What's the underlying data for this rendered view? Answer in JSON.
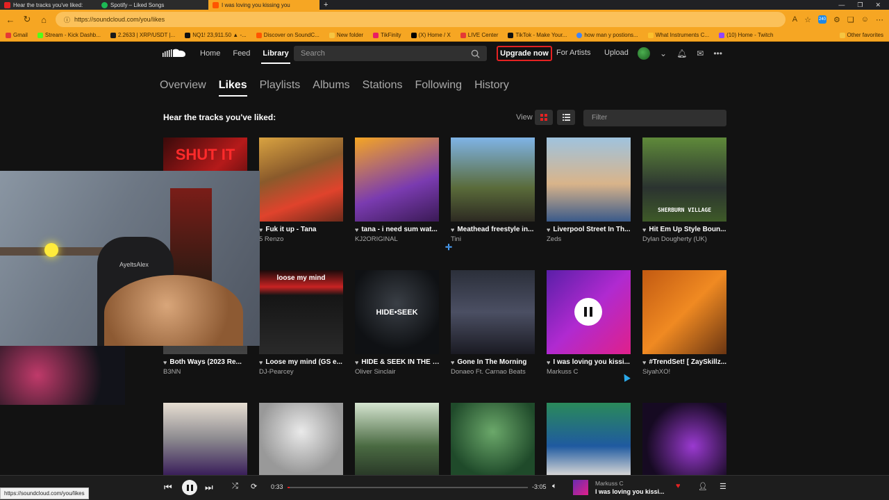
{
  "browser": {
    "tabs": [
      {
        "label": "Hear the tracks you've liked:",
        "color": "#e52222"
      },
      {
        "label": "Spotify – Liked Songs",
        "color": "#1db954"
      },
      {
        "label": "I was loving you kissing you",
        "color": "#ff5500"
      }
    ],
    "url": "https://soundcloud.com/you/likes",
    "bookmarks": [
      "Gmail",
      "Stream - Kick Dashb...",
      "2.2633 | XRP/USDT |...",
      "NQ1! 23,911.50 ▲ -...",
      "Discover on SoundC...",
      "New folder",
      "TikFinity",
      "(X) Home / X",
      "LIVE Center",
      "TikTok - Make Your...",
      "how man y postions...",
      "What Instruments C...",
      "(10) Home - Twitch"
    ],
    "bookmarks_other": "Other favorites",
    "ext_badge": "240"
  },
  "header": {
    "nav": [
      "Home",
      "Feed",
      "Library"
    ],
    "search_placeholder": "Search",
    "upgrade": "Upgrade now",
    "for_artists": "For Artists",
    "upload": "Upload"
  },
  "subtabs": [
    "Overview",
    "Likes",
    "Playlists",
    "Albums",
    "Stations",
    "Following",
    "History"
  ],
  "section_title": "Hear the tracks you've liked:",
  "view_label": "View",
  "filter_placeholder": "Filter",
  "tiles": [
    {
      "title": "",
      "artist": "",
      "bg": "linear-gradient(135deg,#3a0a0a,#b51a1a 50%,#1a0505)",
      "caption": "SHUT IT"
    },
    {
      "title": "Fuk it up - Tana",
      "artist": "5 Renzo",
      "bg": "linear-gradient(160deg,#d9a341,#8a5a2b 40%,#e0432c 70%,#6b2a1a)"
    },
    {
      "title": "tana - i need sum wat...",
      "artist": "KJ2ORIGINAL",
      "bg": "linear-gradient(160deg,#f5a623,#7a3bb0 60%,#3a1a55)"
    },
    {
      "title": "Meathead freestyle in...",
      "artist": "Tini",
      "bg": "linear-gradient(180deg,#7fb4e6 0%,#5a6b3a 60%,#2d2a22)"
    },
    {
      "title": "Liverpool Street In Th...",
      "artist": "Zeds",
      "bg": "linear-gradient(180deg,#9fc3de,#d9b48a 55%,#3a5a8a)"
    },
    {
      "title": "Hit Em Up Style Boun...",
      "artist": "Dylan Dougherty (UK)",
      "bg": "linear-gradient(180deg,#5f8a3a,#2b3330 60%,#3e5a28)",
      "caption": "SHERBURN VILLAGE"
    },
    {
      "title": "Both Ways (2023 Re...",
      "artist": "B3NN",
      "bg": "linear-gradient(180deg,#222,#444)"
    },
    {
      "title": "Loose my mind (GS e...",
      "artist": "DJ-Pearcey",
      "bg": "linear-gradient(180deg,#1a0a0a,#c82323 20%,#151515 30%,#2a2a2a)",
      "caption": "loose my mind"
    },
    {
      "title": "HIDE & SEEK IN THE R...",
      "artist": "Oliver Sinclair",
      "bg": "radial-gradient(circle at 50% 40%,#3a3f46,#0f1114 70%)",
      "caption": "HIDE•SEEK"
    },
    {
      "title": "Gone In The Morning",
      "artist": "Donaeo Ft. Carnao Beats",
      "bg": "linear-gradient(180deg,#2b2f3a,#4b4f63 50%,#1a1a22)"
    },
    {
      "title": "I was loving you kissi...",
      "artist": "Markuss C",
      "bg": "linear-gradient(135deg,#5a1fa8,#b02ad0 50%,#e0208a)",
      "playing": true
    },
    {
      "title": "#TrendSet! [ ZaySkillz...",
      "artist": "SiyahXO!",
      "bg": "linear-gradient(135deg,#c25a12,#f08a22 50%,#6a3512)"
    },
    {
      "title": "",
      "artist": "",
      "bg": "linear-gradient(180deg,#e7ded2,#8c8a8f 50%,#3a1f5a)"
    },
    {
      "title": "",
      "artist": "",
      "bg": "radial-gradient(circle at 50% 40%,#eaeaea,#999 70%)"
    },
    {
      "title": "",
      "artist": "",
      "bg": "linear-gradient(180deg,#d5e5d0,#4a6a42 60%,#2a3a28)"
    },
    {
      "title": "",
      "artist": "",
      "bg": "radial-gradient(circle at 50% 40%,#6ba86a,#1f4a2a 75%)"
    },
    {
      "title": "",
      "artist": "",
      "bg": "linear-gradient(180deg,#2a8a5a,#1f5aa0 60%,#d5d5d5)"
    },
    {
      "title": "",
      "artist": "",
      "bg": "radial-gradient(circle at 60% 60%,#9a3ad0,#160a22 70%)"
    }
  ],
  "webcam": {
    "name": "AyeltsAlex"
  },
  "player": {
    "elapsed": "0:33",
    "remaining": "-3:05",
    "progress_fraction": 0.01,
    "artist": "Markuss C",
    "title": "I was loving you kissi..."
  },
  "status_url": "https://soundcloud.com/you/likes"
}
